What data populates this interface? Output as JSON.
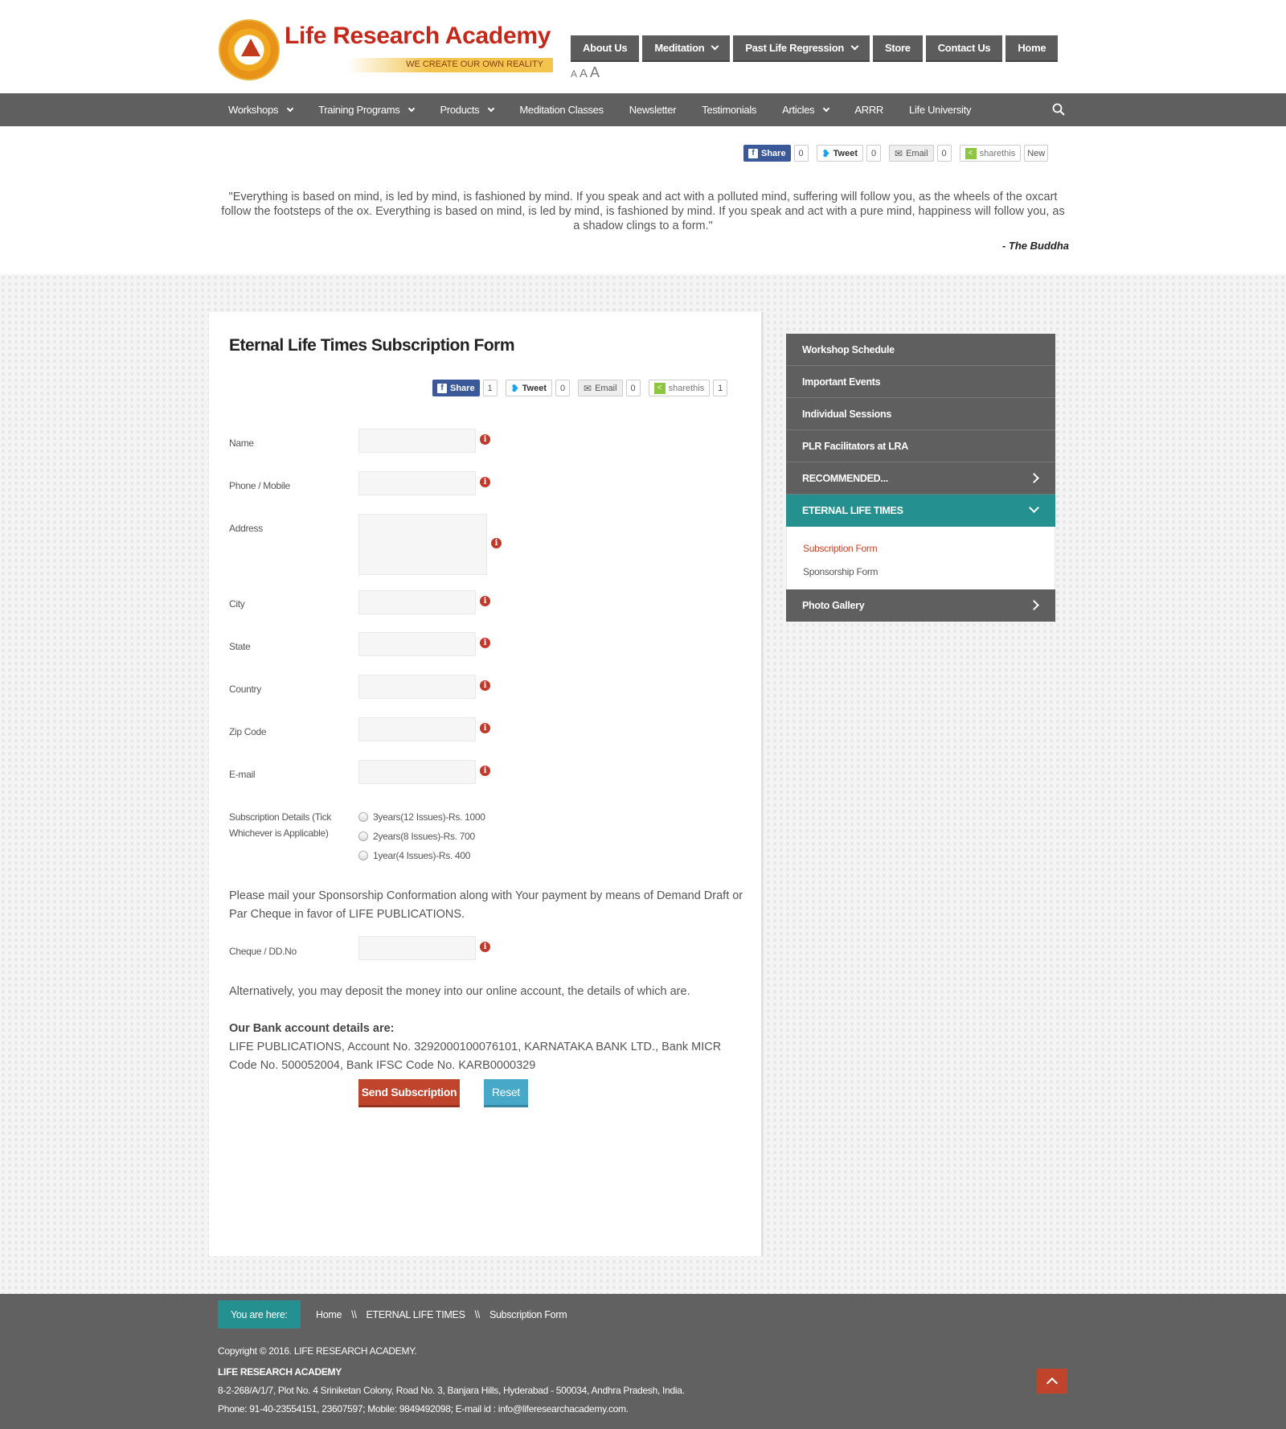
{
  "header": {
    "logo_name": "Life Research Academy",
    "logo_tagline": "WE CREATE OUR OWN REALITY",
    "top_nav": [
      {
        "label": "About Us",
        "dropdown": false
      },
      {
        "label": "Meditation",
        "dropdown": true
      },
      {
        "label": "Past Life Regression",
        "dropdown": true
      },
      {
        "label": "Store",
        "dropdown": false
      },
      {
        "label": "Contact Us",
        "dropdown": false
      },
      {
        "label": "Home",
        "dropdown": false
      }
    ],
    "font_sizes": [
      "A",
      "A",
      "A"
    ]
  },
  "main_nav": [
    {
      "label": "Workshops",
      "dropdown": true
    },
    {
      "label": "Training Programs",
      "dropdown": true
    },
    {
      "label": "Products",
      "dropdown": true
    },
    {
      "label": "Meditation Classes",
      "dropdown": false
    },
    {
      "label": "Newsletter",
      "dropdown": false
    },
    {
      "label": "Testimonials",
      "dropdown": false
    },
    {
      "label": "Articles",
      "dropdown": true
    },
    {
      "label": "ARRR",
      "dropdown": false
    },
    {
      "label": "Life University",
      "dropdown": false
    }
  ],
  "share_top": {
    "share_label": "Share",
    "share_count": "0",
    "tweet_label": "Tweet",
    "tweet_count": "0",
    "email_label": "Email",
    "email_count": "0",
    "sharethis_label": "sharethis",
    "sharethis_count": "New"
  },
  "quote": {
    "text": "\"Everything is based on mind, is led by mind, is fashioned by mind. If you speak and act with a polluted mind, suffering will follow you, as the wheels of the oxcart follow the footsteps of the ox. Everything is based on mind, is led by mind, is fashioned by mind. If you speak and act with a pure mind, happiness will follow you, as a shadow clings to a form.\"",
    "author": "- The Buddha"
  },
  "form": {
    "title": "Eternal Life Times Subscription Form",
    "share": {
      "share_label": "Share",
      "share_count": "1",
      "tweet_label": "Tweet",
      "tweet_count": "0",
      "email_label": "Email",
      "email_count": "0",
      "sharethis_label": "sharethis",
      "sharethis_count": "1"
    },
    "fields": {
      "name": "Name",
      "phone": "Phone / Mobile",
      "address": "Address",
      "city": "City",
      "state": "State",
      "country": "Country",
      "zip": "Zip Code",
      "email": "E-mail",
      "subscription": "Subscription Details (Tick Whichever is Applicable)",
      "cheque": "Cheque / DD.No"
    },
    "subscription_options": [
      "3years(12 Issues)-Rs. 1000",
      "2years(8 Issues)-Rs. 700",
      "1year(4 Issues)-Rs. 400"
    ],
    "mail_note": "Please mail your Sponsorship Conformation along with Your payment by means of Demand Draft or Par Cheque in favor of LIFE PUBLICATIONS.",
    "online_note": "Alternatively, you may deposit the money into our online account, the details of which are.",
    "bank_heading": "Our Bank account details are:",
    "bank_details": "LIFE PUBLICATIONS, Account No. 3292000100076101, KARNATAKA BANK LTD., Bank MICR Code No. 500052004, Bank IFSC Code No. KARB0000329",
    "send_label": "Send Subscription",
    "reset_label": "Reset"
  },
  "sidebar": {
    "items": [
      {
        "label": "Workshop Schedule"
      },
      {
        "label": "Important Events"
      },
      {
        "label": "Individual Sessions"
      },
      {
        "label": "PLR Facilitators at LRA"
      },
      {
        "label": "RECOMMENDED..."
      },
      {
        "label": "ETERNAL LIFE TIMES"
      }
    ],
    "sub_items": [
      "Subscription Form",
      "Sponsorship Form"
    ],
    "last_item": "Photo Gallery"
  },
  "footer": {
    "you_are_here": "You are here:",
    "breadcrumb": [
      "Home",
      "ETERNAL LIFE TIMES",
      "Subscription Form"
    ],
    "separator": "\\\\",
    "copyright": "Copyright © 2016. LIFE RESEARCH ACADEMY.",
    "org": "LIFE RESEARCH ACADEMY",
    "address": "8-2-268/A/1/7, Plot No. 4 Sriniketan Colony, Road No. 3, Banjara Hills, Hyderabad - 500034, Andhra Pradesh, India.",
    "contact": "Phone: 91-40-23554151, 23607597; Mobile: 9849492098; E-mail id : info@liferesearchacademy.com."
  },
  "colors": {
    "brand_red": "#c4281b",
    "nav_gray": "#5f5f5f",
    "teal": "#24908f",
    "button_red": "#c0432b",
    "button_blue": "#47a9c7"
  }
}
